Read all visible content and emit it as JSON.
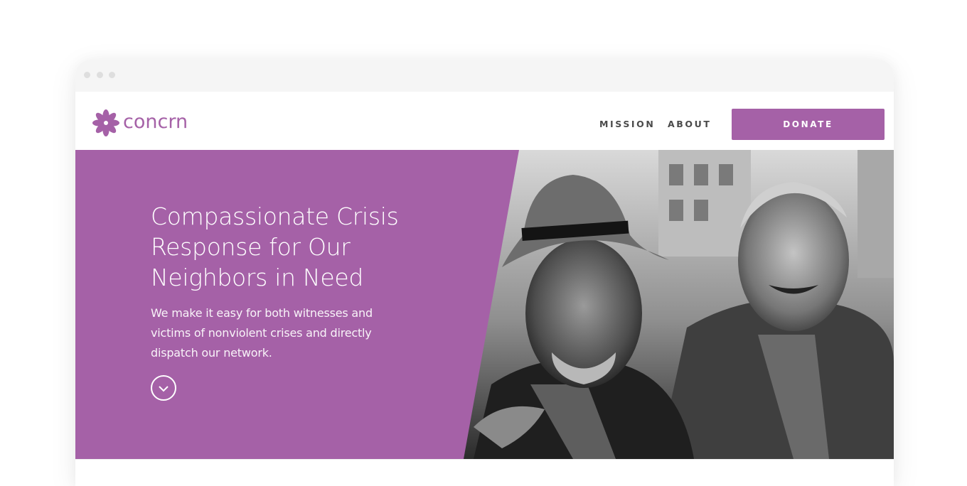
{
  "brand": {
    "name": "concrn",
    "logo_icon": "flower-logo-icon",
    "accent_color": "#a561a7"
  },
  "nav": {
    "links": [
      "MISSION",
      "ABOUT"
    ],
    "donate_label": "DONATE"
  },
  "hero": {
    "title": "Compassionate Crisis Response for Our Neighbors in Need",
    "subtitle": "We make it easy for both witnesses and victims of nonviolent crises and directly dispatch our network.",
    "scroll_icon": "chevron-down-icon",
    "image": "black-and-white photo of two smiling men, one in a hat, arm around each other"
  },
  "window": {
    "chrome_dots": 3
  }
}
